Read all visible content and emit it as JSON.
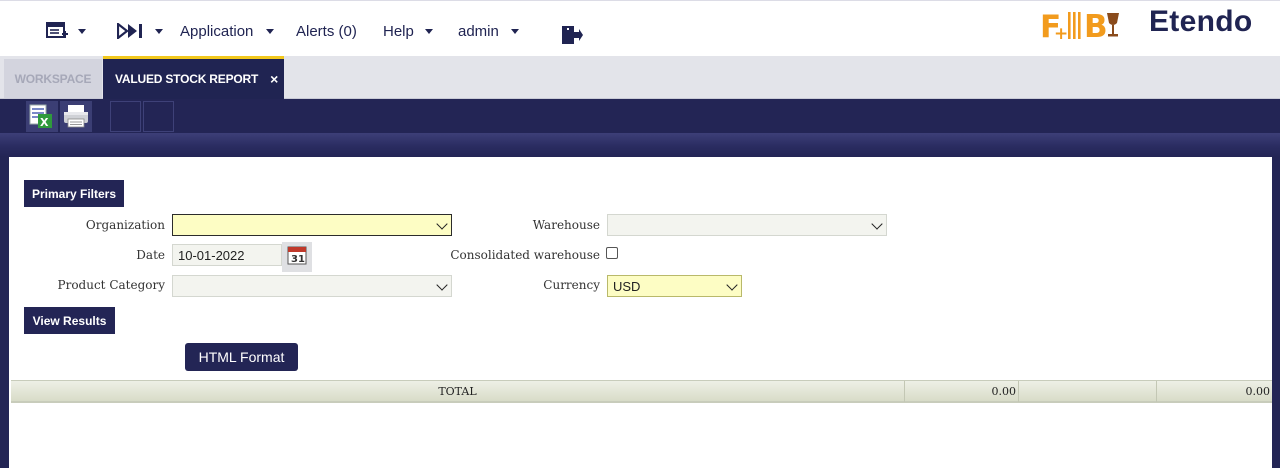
{
  "nav": {
    "application": "Application",
    "alerts": "Alerts (0)",
    "help": "Help",
    "user": "admin",
    "icons": [
      "new-window-icon",
      "quick-launch-icon",
      "logout-icon"
    ]
  },
  "logos": {
    "brand_left": "F+IB",
    "brand_right": "Etendo"
  },
  "tabs": {
    "workspace": "WORKSPACE",
    "active": "VALUED STOCK REPORT",
    "close": "×"
  },
  "toolbar": {
    "icons": [
      "export-spreadsheet-icon",
      "print-icon"
    ]
  },
  "filters": {
    "section_label": "Primary Filters",
    "organization": {
      "label": "Organization",
      "value": ""
    },
    "date": {
      "label": "Date",
      "value": "10-01-2022"
    },
    "product_category": {
      "label": "Product Category",
      "value": ""
    },
    "warehouse": {
      "label": "Warehouse",
      "value": ""
    },
    "consolidated": {
      "label": "Consolidated warehouse",
      "checked": false
    },
    "currency": {
      "label": "Currency",
      "value": "USD"
    }
  },
  "results": {
    "section_label": "View Results",
    "html_button": "HTML Format",
    "total_label": "TOTAL",
    "total_value_1": "0.00",
    "total_value_2": "0.00"
  },
  "colors": {
    "primary": "#232555",
    "accent": "#f2c81d",
    "required": "#fdfdc4"
  }
}
